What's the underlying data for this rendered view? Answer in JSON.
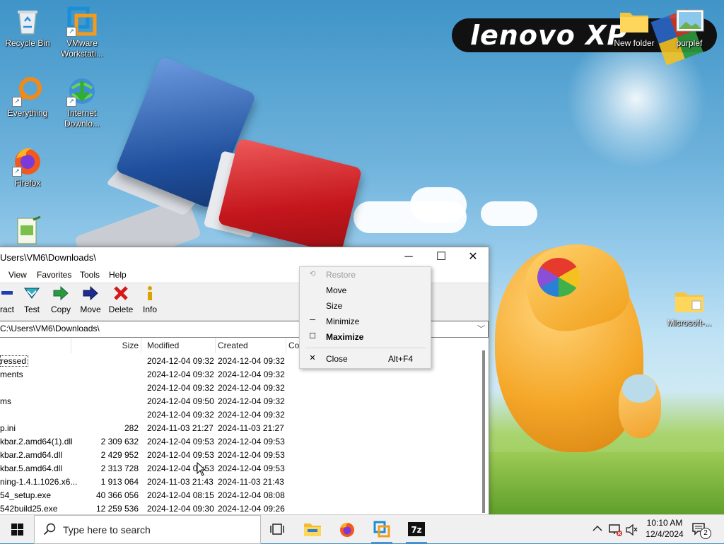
{
  "desktop": {
    "icons": [
      {
        "label": "Recycle Bin",
        "icon": "recycle-bin-icon",
        "shortcut": false
      },
      {
        "label": "VMware Workstati...",
        "icon": "vmware-icon",
        "shortcut": true
      },
      {
        "label": "Everything",
        "icon": "everything-search-icon",
        "shortcut": true
      },
      {
        "label": "Internet Downlo...",
        "icon": "internet-download-manager-icon",
        "shortcut": true
      },
      {
        "label": "Firefox",
        "icon": "firefox-icon",
        "shortcut": true
      },
      {
        "label": "",
        "icon": "notepad-file-icon",
        "shortcut": false
      },
      {
        "label": "New folder",
        "icon": "folder-icon",
        "shortcut": false
      },
      {
        "label": "purplef",
        "icon": "image-file-icon",
        "shortcut": false
      },
      {
        "label": "Microsoft-...",
        "icon": "folder-icon",
        "shortcut": false
      }
    ],
    "wallpaper_logo": "lenovo XP"
  },
  "window": {
    "title": "Users\\VM6\\Downloads\\",
    "menu": [
      "View",
      "Favorites",
      "Tools",
      "Help"
    ],
    "toolbar": [
      {
        "label": "ract",
        "icon": "extract-icon"
      },
      {
        "label": "Test",
        "icon": "test-icon"
      },
      {
        "label": "Copy",
        "icon": "copy-icon"
      },
      {
        "label": "Move",
        "icon": "move-icon"
      },
      {
        "label": "Delete",
        "icon": "delete-icon"
      },
      {
        "label": "Info",
        "icon": "info-icon"
      }
    ],
    "address": "C:\\Users\\VM6\\Downloads\\",
    "columns": {
      "size": "Size",
      "modified": "Modified",
      "created": "Created",
      "comment": "Co"
    },
    "rows": [
      {
        "name": "ressed",
        "size": "",
        "modified": "2024-12-04 09:32",
        "created": "2024-12-04 09:32",
        "selected": true
      },
      {
        "name": "ments",
        "size": "",
        "modified": "2024-12-04 09:32",
        "created": "2024-12-04 09:32",
        "selected": false
      },
      {
        "name": "",
        "size": "",
        "modified": "2024-12-04 09:32",
        "created": "2024-12-04 09:32",
        "selected": false
      },
      {
        "name": "ms",
        "size": "",
        "modified": "2024-12-04 09:50",
        "created": "2024-12-04 09:32",
        "selected": false
      },
      {
        "name": "",
        "size": "",
        "modified": "2024-12-04 09:32",
        "created": "2024-12-04 09:32",
        "selected": false
      },
      {
        "name": "p.ini",
        "size": "282",
        "modified": "2024-11-03 21:27",
        "created": "2024-11-03 21:27",
        "selected": false
      },
      {
        "name": "kbar.2.amd64(1).dll",
        "size": "2 309 632",
        "modified": "2024-12-04 09:53",
        "created": "2024-12-04 09:53",
        "selected": false
      },
      {
        "name": "kbar.2.amd64.dll",
        "size": "2 429 952",
        "modified": "2024-12-04 09:53",
        "created": "2024-12-04 09:53",
        "selected": false
      },
      {
        "name": "kbar.5.amd64.dll",
        "size": "2 313 728",
        "modified": "2024-12-04 09:53",
        "created": "2024-12-04 09:53",
        "selected": false
      },
      {
        "name": "ning-1.4.1.1026.x6...",
        "size": "1 913 064",
        "modified": "2024-11-03 21:43",
        "created": "2024-11-03 21:43",
        "selected": false
      },
      {
        "name": "54_setup.exe",
        "size": "40 366 056",
        "modified": "2024-12-04 08:15",
        "created": "2024-12-04 08:08",
        "selected": false
      },
      {
        "name": "542build25.exe",
        "size": "12 259 536",
        "modified": "2024-12-04 09:30",
        "created": "2024-12-04 09:26",
        "selected": false
      }
    ]
  },
  "context_menu": {
    "items": [
      {
        "label": "Restore",
        "icon": "restore-icon",
        "disabled": true,
        "bold": false,
        "accel": ""
      },
      {
        "label": "Move",
        "icon": "",
        "disabled": false,
        "bold": false,
        "accel": ""
      },
      {
        "label": "Size",
        "icon": "",
        "disabled": false,
        "bold": false,
        "accel": ""
      },
      {
        "label": "Minimize",
        "icon": "minimize-icon",
        "disabled": false,
        "bold": false,
        "accel": ""
      },
      {
        "label": "Maximize",
        "icon": "maximize-icon",
        "disabled": false,
        "bold": true,
        "accel": ""
      },
      {
        "label": "Close",
        "icon": "close-icon",
        "disabled": false,
        "bold": false,
        "accel": "Alt+F4"
      }
    ]
  },
  "taskbar": {
    "search_placeholder": "Type here to search",
    "apps": [
      "task-view-icon",
      "file-explorer-icon",
      "firefox-icon",
      "vmware-icon",
      "7zip-icon"
    ],
    "clock_time": "10:10 AM",
    "clock_date": "12/4/2024",
    "notification_count": "2"
  },
  "colors": {
    "accent": "#4a90d9",
    "selection_border": "#333333"
  }
}
